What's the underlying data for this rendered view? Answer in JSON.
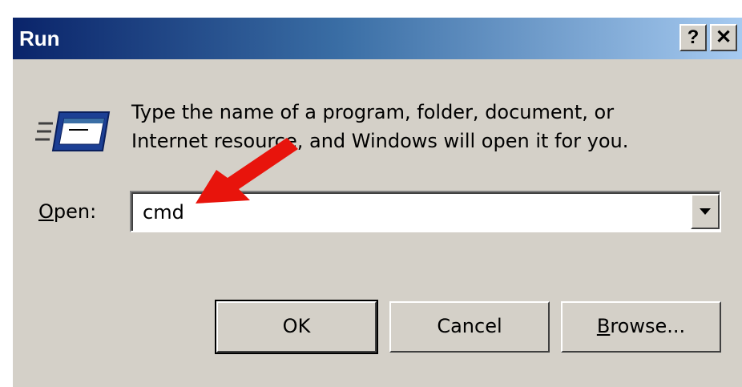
{
  "window": {
    "title": "Run",
    "help_label": "?",
    "close_label": "✕"
  },
  "icon": "run-dialog-icon",
  "description": {
    "line1": "Type the name of a program, folder, document, or",
    "line2": "Internet resource, and Windows will open it for you."
  },
  "open_field": {
    "label_first": "O",
    "label_rest": "pen:",
    "value": "cmd"
  },
  "buttons": {
    "ok": "OK",
    "cancel": "Cancel",
    "browse_first": "B",
    "browse_rest": "rowse..."
  },
  "colors": {
    "dialog_bg": "#d4d0c8",
    "titlebar_start": "#0a246a",
    "titlebar_end": "#a6caf0",
    "annotation_arrow": "#e8140c"
  }
}
